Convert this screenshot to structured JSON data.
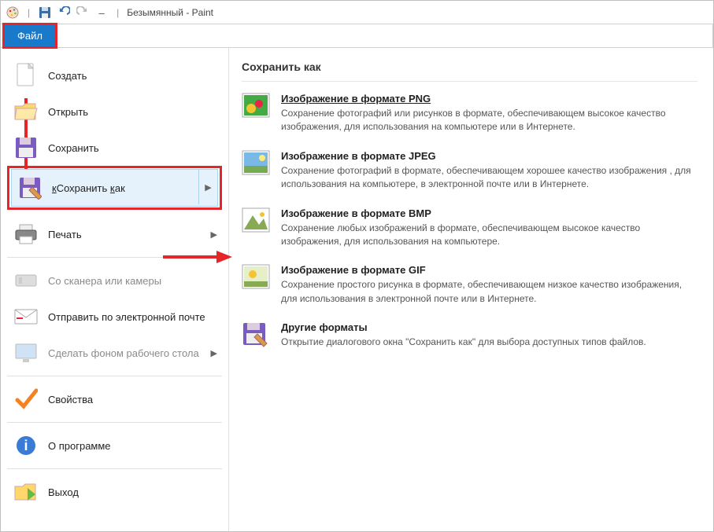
{
  "titlebar": {
    "app": "Безымянный - Paint"
  },
  "tabs": {
    "file": "Файл"
  },
  "menu": {
    "new": "Создать",
    "open": "Открыть",
    "save": "Сохранить",
    "saveas": "Сохранить как",
    "print": "Печать",
    "scanner": "Со сканера или камеры",
    "email": "Отправить по электронной почте",
    "wallpaper": "Сделать фоном рабочего стола",
    "properties": "Свойства",
    "about": "О программе",
    "exit": "Выход"
  },
  "panel": {
    "header": "Сохранить как",
    "png_title": "Изображение в формате PNG",
    "png_desc": "Сохранение фотографий или рисунков в формате, обеспечивающем высокое качество изображения, для использования на компьютере или в Интернете.",
    "jpeg_title": "Изображение в формате JPEG",
    "jpeg_desc": "Сохранение фотографий в формате, обеспечивающем хорошее качество изображения , для использования на компьютере, в электронной почте или в Интернете.",
    "bmp_title": "Изображение в формате BMP",
    "bmp_desc": "Сохранение любых изображений в формате, обеспечивающем высокое качество изображения, для использования на компьютере.",
    "gif_title": "Изображение в формате GIF",
    "gif_desc": "Сохранение простого рисунка в формате, обеспечивающем низкое качество изображения, для использования в электронной почте или в Интернете.",
    "other_title": "Другие форматы",
    "other_desc": "Открытие диалогового окна \"Сохранить как\" для выбора доступных типов файлов."
  }
}
